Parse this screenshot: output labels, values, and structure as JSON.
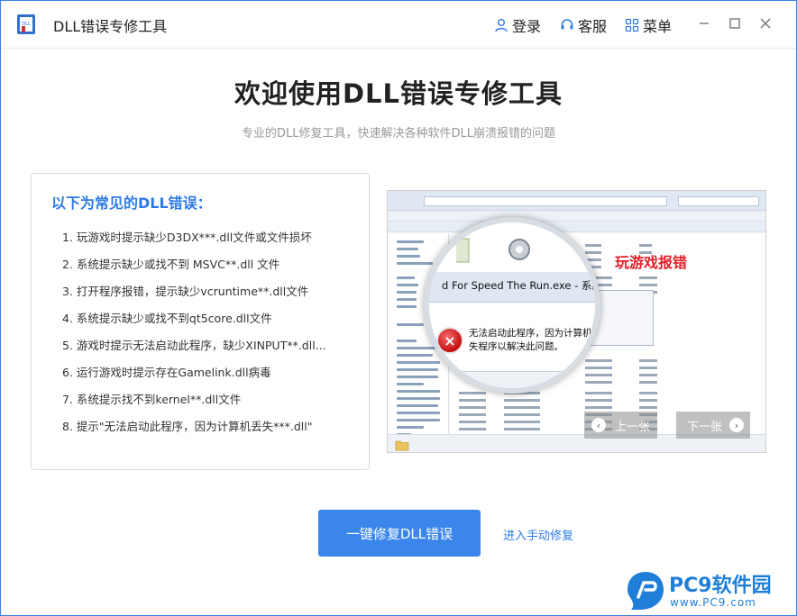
{
  "app": {
    "title": "DLL错误专修工具",
    "logo_text": "DLL"
  },
  "titlebar": {
    "login_label": "登录",
    "support_label": "客服",
    "menu_label": "菜单"
  },
  "main": {
    "title": "欢迎使用DLL错误专修工具",
    "subtitle": "专业的DLL修复工具，快速解决各种软件DLL崩溃报错的问题"
  },
  "error_panel": {
    "heading": "以下为常见的DLL错误：",
    "items": [
      "1. 玩游戏时提示缺少D3DX***.dll文件或文件损坏",
      "2. 系统提示缺少或找不到 MSVC**.dll 文件",
      "3. 打开程序报错，提示缺少vcruntime**.dll文件",
      "4. 系统提示缺少或找不到qt5core.dll文件",
      "5. 游戏时提示无法启动此程序，缺少XINPUT**.dll...",
      "6. 运行游戏时提示存在Gamelink.dll病毒",
      "7. 系统提示找不到kernel**.dll文件",
      "8. 提示\"无法启动此程序，因为计算机丢失***.dll\""
    ]
  },
  "screenshot": {
    "label": "玩游戏报错",
    "dialog_title": "d For Speed The Run.exe - 系统错误",
    "dialog_message": "无法启动此程序，因为计算机中丢失程序以解决此问题。",
    "prev_label": "上一张",
    "next_label": "下一张"
  },
  "actions": {
    "fix_button": "一键修复DLL错误",
    "manual_link": "进入手动修复"
  },
  "watermark": {
    "name": "PC9软件园",
    "url": "www.PC9.com"
  },
  "colors": {
    "accent": "#3a86ea",
    "heading_blue": "#2d7ae6",
    "error_red": "#e0202a"
  }
}
